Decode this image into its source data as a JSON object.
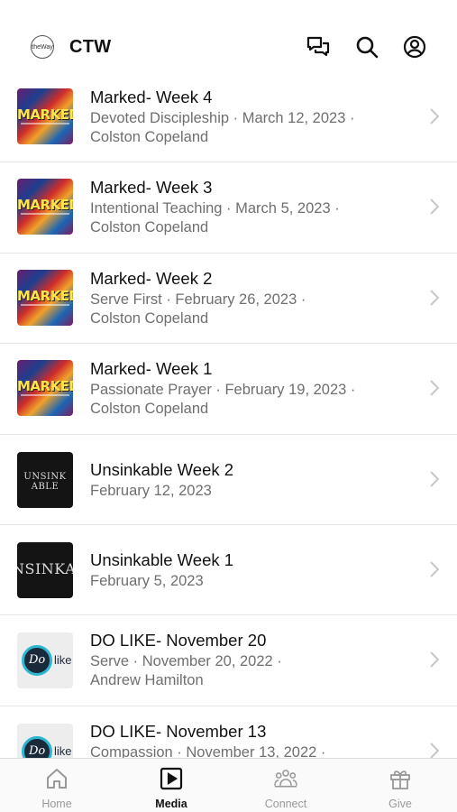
{
  "header": {
    "app_title": "CTW",
    "logo_text": "theWay"
  },
  "items": [
    {
      "title": "Marked- Week 4",
      "meta_line1": "Devoted Discipleship · March 12, 2023 ·",
      "meta_line2": "Colston Copeland",
      "thumb": "MARKED"
    },
    {
      "title": "Marked- Week 3",
      "meta_line1": "Intentional Teaching · March 5, 2023 ·",
      "meta_line2": "Colston Copeland",
      "thumb": "MARKED"
    },
    {
      "title": "Marked- Week 2",
      "meta_line1": "Serve First · February 26, 2023 ·",
      "meta_line2": "Colston Copeland",
      "thumb": "MARKED"
    },
    {
      "title": "Marked- Week 1",
      "meta_line1": "Passionate Prayer · February 19, 2023 ·",
      "meta_line2": "Colston Copeland",
      "thumb": "MARKED"
    },
    {
      "title": "Unsinkable Week 2",
      "meta_line1": "February 12, 2023",
      "thumb": "UNSINK ABLE"
    },
    {
      "title": "Unsinkable Week 1",
      "meta_line1": "February 5, 2023",
      "thumb": "NSINKABI"
    },
    {
      "title": "DO LIKE- November 20",
      "meta_line1": "Serve · November 20, 2022 ·",
      "meta_line2": "Andrew Hamilton",
      "thumb_mark": "Do",
      "thumb_word": "like"
    },
    {
      "title": "DO LIKE- November 13",
      "meta_line1": "Compassion · November 13, 2022 ·",
      "thumb_mark": "Do",
      "thumb_word": "like"
    }
  ],
  "tabs": [
    {
      "label": "Home"
    },
    {
      "label": "Media"
    },
    {
      "label": "Connect"
    },
    {
      "label": "Give"
    }
  ],
  "colors": {
    "active_tab": "#111111",
    "inactive_tab": "#999999",
    "meta_text": "#6f6f6f"
  }
}
